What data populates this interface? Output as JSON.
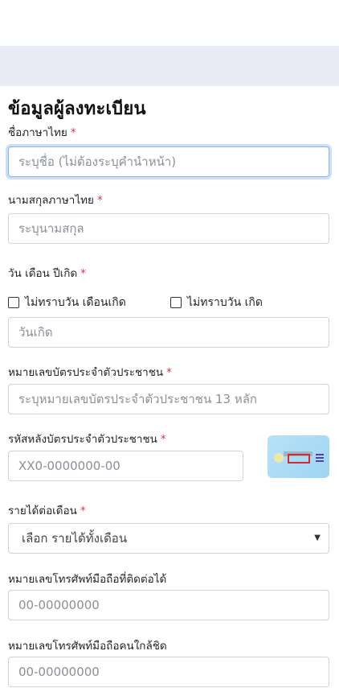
{
  "form": {
    "title": "ข้อมูลผู้ลงทะเบียน",
    "required_mark": "*",
    "first_name": {
      "label": "ชื่อภาษาไทย",
      "placeholder": "ระบุชื่อ (ไม่ต้องระบุคำนำหน้า)"
    },
    "last_name": {
      "label": "นามสกุลภาษาไทย",
      "placeholder": "ระบุนามสกุล"
    },
    "birth_date": {
      "label": "วัน เดือน ปีเกิด",
      "checkbox_unknown_day_month": "ไม่ทราบวัน เดือนเกิด",
      "checkbox_unknown_day": "ไม่ทราบวัน เกิด",
      "placeholder": "วันเกิด"
    },
    "id_card": {
      "label": "หมายเลขบัตรประจำตัวประชาชน",
      "placeholder": "ระบุหมายเลขบัตรประจำตัวประชาชน 13 หลัก"
    },
    "laser_code": {
      "label": "รหัสหลังบัตรประจำตัวประชาชน",
      "placeholder": "XX0-0000000-00"
    },
    "income": {
      "label": "รายได้ต่อเดือน",
      "selected": "เลือก รายได้ทั้งเดือน"
    },
    "phone": {
      "label": "หมายเลขโทรศัพท์มือถือที่ติดต่อได้",
      "placeholder": "00-00000000"
    },
    "relative_phone": {
      "label": "หมายเลขโทรศัพท์มือถือคนใกล้ชิด",
      "placeholder": "00-00000000"
    }
  },
  "colors": {
    "band": "#e9ecf6",
    "required": "#dc3545",
    "focus": "#86b7e4"
  },
  "icons": {
    "select_arrow": "caret-down-icon",
    "card": "id-card-back-icon"
  }
}
